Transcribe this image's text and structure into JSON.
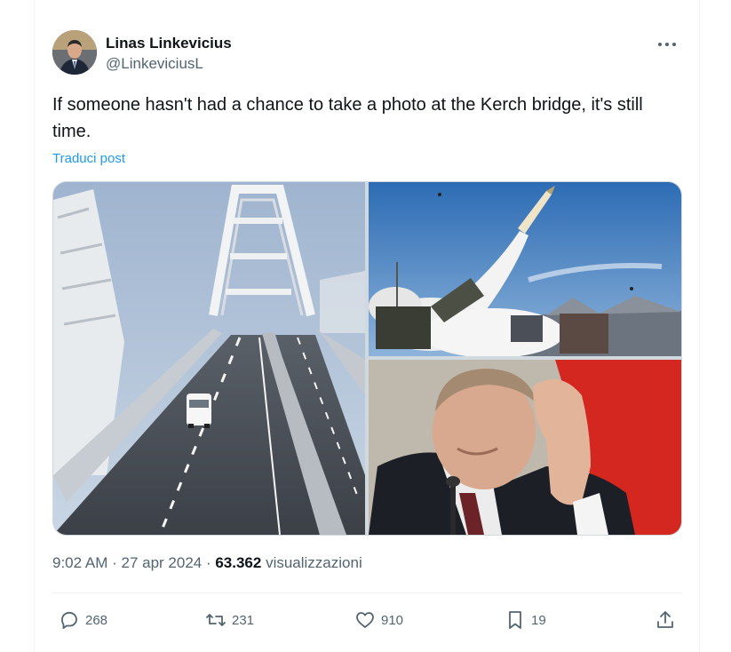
{
  "author": {
    "display_name": "Linas Linkevicius",
    "handle": "@LinkeviciusL"
  },
  "tweet": {
    "text": "If someone hasn't had a chance to take a photo at the Kerch bridge, it's still time.",
    "translate_label": "Traduci post"
  },
  "meta": {
    "time": "9:02 AM",
    "sep1": " · ",
    "date": "27 apr 2024",
    "sep2": " · ",
    "views_count": "63.362",
    "views_label": " visualizzazioni"
  },
  "actions": {
    "replies": "268",
    "reposts": "231",
    "likes": "910",
    "bookmarks": "19"
  },
  "icons": {
    "more": "more-dots-icon",
    "reply": "reply-icon",
    "repost": "repost-icon",
    "like": "heart-icon",
    "bookmark": "bookmark-icon",
    "share": "share-icon"
  },
  "colors": {
    "link": "#1d9bf0",
    "secondary": "#536471",
    "text": "#0f1419",
    "border": "#eff3f4"
  }
}
